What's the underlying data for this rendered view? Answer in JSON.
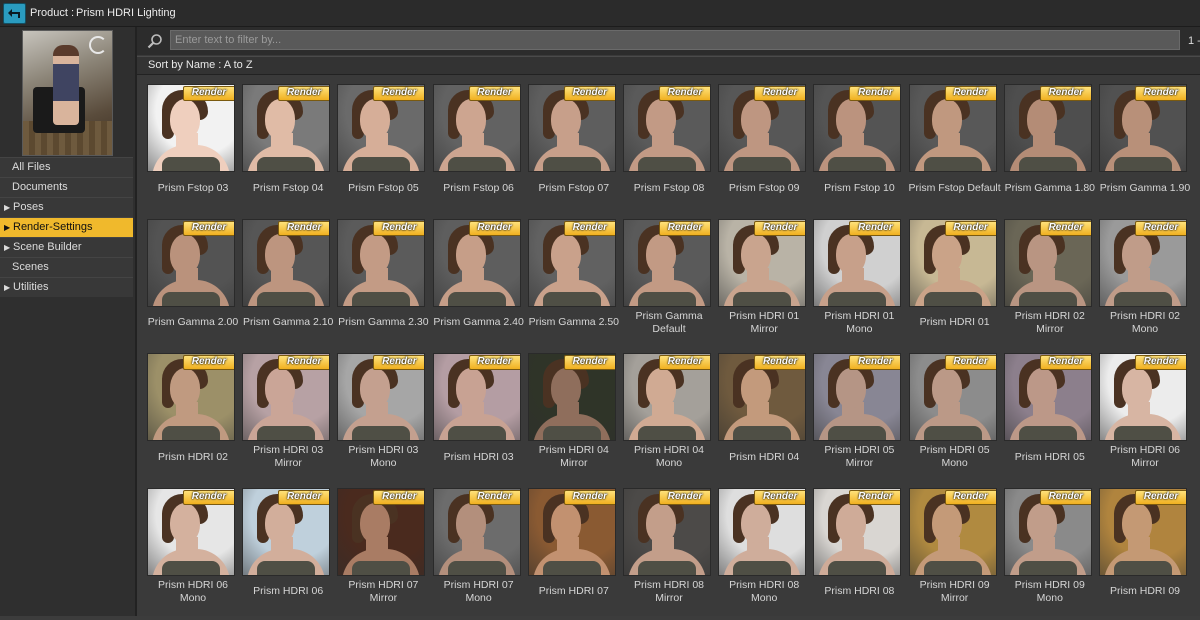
{
  "header": {
    "product_label": "Product :",
    "product_name": "Prism HDRI Lighting"
  },
  "sidebar": {
    "items": [
      {
        "label": "All Files",
        "arrow": false,
        "selected": false
      },
      {
        "label": "Documents",
        "arrow": false,
        "selected": false
      },
      {
        "label": "Poses",
        "arrow": true,
        "selected": false
      },
      {
        "label": "Render-Settings",
        "arrow": true,
        "selected": true
      },
      {
        "label": "Scene Builder",
        "arrow": true,
        "selected": false
      },
      {
        "label": "Scenes",
        "arrow": false,
        "selected": false
      },
      {
        "label": "Utilities",
        "arrow": true,
        "selected": false
      }
    ]
  },
  "filter": {
    "placeholder": "Enter text to filter by...",
    "page_count": "1 -"
  },
  "sort": {
    "label": "Sort by Name : A to Z"
  },
  "badge_label": "Render",
  "items": [
    {
      "name": "Prism Fstop 03",
      "bg": "#f2f2f2",
      "skin": "#efcfbe"
    },
    {
      "name": "Prism Fstop 04",
      "bg": "#7a7a7a",
      "skin": "#e0bba6"
    },
    {
      "name": "Prism Fstop 05",
      "bg": "#6a6a6a",
      "skin": "#d6ae98"
    },
    {
      "name": "Prism Fstop 06",
      "bg": "#626262",
      "skin": "#cda590"
    },
    {
      "name": "Prism Fstop 07",
      "bg": "#5e5e5e",
      "skin": "#c79f8a"
    },
    {
      "name": "Prism Fstop 08",
      "bg": "#5a5a5a",
      "skin": "#c29a85"
    },
    {
      "name": "Prism Fstop 09",
      "bg": "#575757",
      "skin": "#be9681"
    },
    {
      "name": "Prism Fstop 10",
      "bg": "#545454",
      "skin": "#bb937e"
    },
    {
      "name": "Prism Fstop Default",
      "bg": "#585858",
      "skin": "#c0987f"
    },
    {
      "name": "Prism Gamma 1.80",
      "bg": "#4e4e4e",
      "skin": "#b48c76"
    },
    {
      "name": "Prism Gamma 1.90",
      "bg": "#515151",
      "skin": "#b89079"
    },
    {
      "name": "Prism Gamma 2.00",
      "bg": "#535353",
      "skin": "#ba927c"
    },
    {
      "name": "Prism Gamma 2.10",
      "bg": "#565656",
      "skin": "#bd957f"
    },
    {
      "name": "Prism Gamma 2.30",
      "bg": "#5b5b5b",
      "skin": "#c39b85"
    },
    {
      "name": "Prism Gamma 2.40",
      "bg": "#5e5e5e",
      "skin": "#c69e88"
    },
    {
      "name": "Prism Gamma 2.50",
      "bg": "#616161",
      "skin": "#c9a18b"
    },
    {
      "name": "Prism Gamma Default",
      "bg": "#5a5a5a",
      "skin": "#c29a84"
    },
    {
      "name": "Prism HDRI 01 Mirror",
      "bg": "#b9b3a6",
      "skin": "#c9a48e"
    },
    {
      "name": "Prism HDRI 01 Mono",
      "bg": "#d0d0d0",
      "skin": "#c7a08a"
    },
    {
      "name": "Prism HDRI 01",
      "bg": "#c7b894",
      "skin": "#caa388"
    },
    {
      "name": "Prism HDRI 02 Mirror",
      "bg": "#6a6656",
      "skin": "#b99582"
    },
    {
      "name": "Prism HDRI 02 Mono",
      "bg": "#9a9a9a",
      "skin": "#c09c89"
    },
    {
      "name": "Prism HDRI 02",
      "bg": "#9c9068",
      "skin": "#c09a80"
    },
    {
      "name": "Prism HDRI 03 Mirror",
      "bg": "#b7a1a4",
      "skin": "#caa597"
    },
    {
      "name": "Prism HDRI 03 Mono",
      "bg": "#a6a6a6",
      "skin": "#c4a08f"
    },
    {
      "name": "Prism HDRI 03",
      "bg": "#b49da3",
      "skin": "#c8a293"
    },
    {
      "name": "Prism HDRI 04 Mirror",
      "bg": "#2f3428",
      "skin": "#8f6e5c"
    },
    {
      "name": "Prism HDRI 04 Mono",
      "bg": "#a4a09a",
      "skin": "#d0aa93"
    },
    {
      "name": "Prism HDRI 04",
      "bg": "#6f5a3e",
      "skin": "#c39a7c"
    },
    {
      "name": "Prism HDRI 05 Mirror",
      "bg": "#888694",
      "skin": "#b59585"
    },
    {
      "name": "Prism HDRI 05 Mono",
      "bg": "#8c8c8c",
      "skin": "#bb9987"
    },
    {
      "name": "Prism HDRI 05",
      "bg": "#8c7f8c",
      "skin": "#bc9888"
    },
    {
      "name": "Prism HDRI 06 Mirror",
      "bg": "#ececec",
      "skin": "#d7b5a3"
    },
    {
      "name": "Prism HDRI 06 Mono",
      "bg": "#e6e6e6",
      "skin": "#d4b19e"
    },
    {
      "name": "Prism HDRI 06",
      "bg": "#bfd0dc",
      "skin": "#d2ae9b"
    },
    {
      "name": "Prism HDRI 07 Mirror",
      "bg": "#4a2a1e",
      "skin": "#a97c64"
    },
    {
      "name": "Prism HDRI 07 Mono",
      "bg": "#6c6c6c",
      "skin": "#b38f7c"
    },
    {
      "name": "Prism HDRI 07",
      "bg": "#8a5a32",
      "skin": "#c29170"
    },
    {
      "name": "Prism HDRI 08 Mirror",
      "bg": "#4c4a48",
      "skin": "#c39e8a"
    },
    {
      "name": "Prism HDRI 08 Mono",
      "bg": "#dedede",
      "skin": "#cfad9b"
    },
    {
      "name": "Prism HDRI 08",
      "bg": "#d9d6d2",
      "skin": "#cfab98"
    },
    {
      "name": "Prism HDRI 09 Mirror",
      "bg": "#b08a40",
      "skin": "#c49a78"
    },
    {
      "name": "Prism HDRI 09 Mono",
      "bg": "#8a8a8a",
      "skin": "#c19d8a"
    },
    {
      "name": "Prism HDRI 09",
      "bg": "#b0843e",
      "skin": "#c49974"
    }
  ]
}
